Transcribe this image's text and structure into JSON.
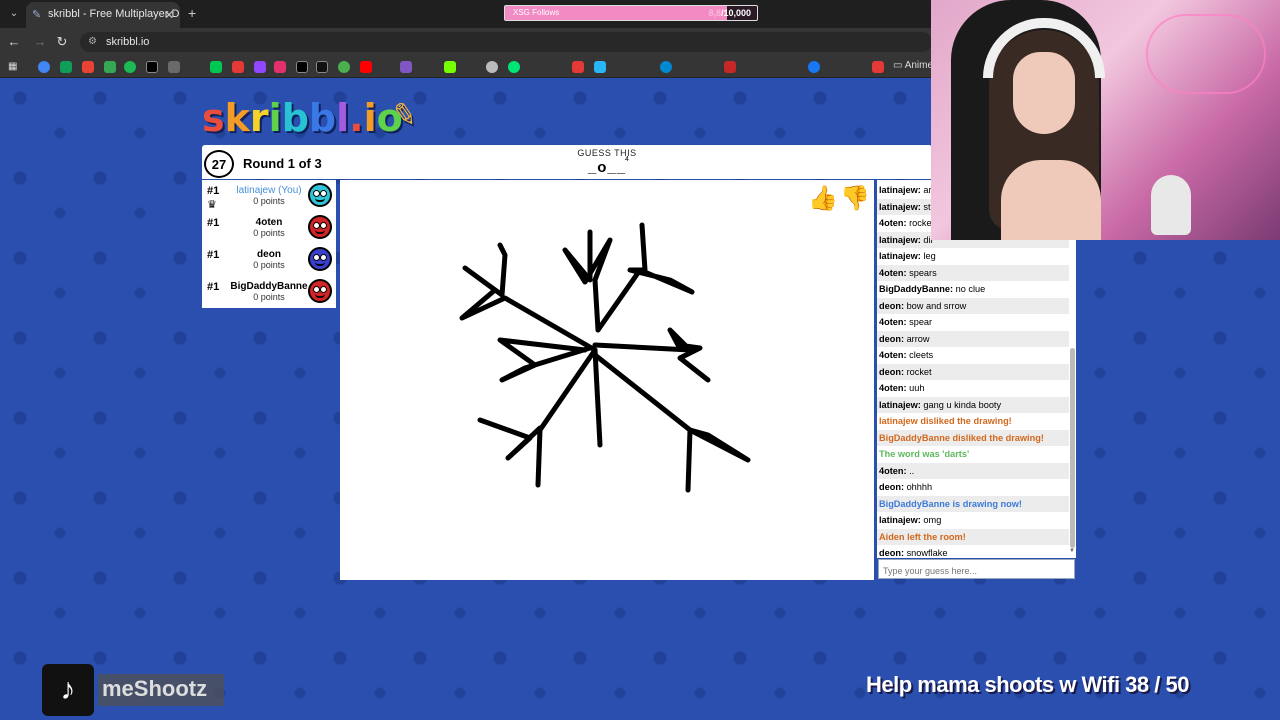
{
  "browser": {
    "tab_title": "skribbl - Free Multiplayer Draw",
    "url": "skribbl.io",
    "bookmark_folder": "Anime"
  },
  "stream_overlay": {
    "follows_label": "XSG Follows",
    "follows_count": "8,8",
    "follows_goal": "/10,000",
    "tiktok_handle": "meShootz",
    "goal_text": "Help mama shoots w Wifi  38 / 50"
  },
  "game": {
    "logo": [
      "s",
      "k",
      "r",
      "i",
      "b",
      "b",
      "l",
      ".",
      "i",
      "o"
    ],
    "timer": "27",
    "round": "Round 1 of 3",
    "guess_label": "GUESS THIS",
    "word_hint": "_o__",
    "letter_count": "4",
    "players": [
      {
        "rank": "#1",
        "name": "latinajew (You)",
        "points": "0 points",
        "color": "#2ec6d6",
        "is_you": true
      },
      {
        "rank": "#1",
        "name": "4oten",
        "points": "0 points",
        "color": "#d32525",
        "is_you": false
      },
      {
        "rank": "#1",
        "name": "deon",
        "points": "0 points",
        "color": "#3a3fd0",
        "is_you": false
      },
      {
        "rank": "#1",
        "name": "BigDaddyBanne",
        "points": "0 points",
        "color": "#d32525",
        "is_you": false
      }
    ],
    "chat": [
      {
        "user": "latinajew:",
        "text": " ar",
        "type": "normal"
      },
      {
        "user": "latinajew:",
        "text": " st",
        "type": "normal"
      },
      {
        "user": "4oten:",
        "text": " rocke",
        "type": "normal"
      },
      {
        "user": "latinajew:",
        "text": " dir",
        "type": "normal"
      },
      {
        "user": "latinajew:",
        "text": " leg",
        "type": "normal"
      },
      {
        "user": "4oten:",
        "text": " spears",
        "type": "normal"
      },
      {
        "user": "BigDaddyBanne:",
        "text": " no clue",
        "type": "normal"
      },
      {
        "user": "deon:",
        "text": " bow and srrow",
        "type": "normal"
      },
      {
        "user": "4oten:",
        "text": " spear",
        "type": "normal"
      },
      {
        "user": "deon:",
        "text": " arrow",
        "type": "normal"
      },
      {
        "user": "4oten:",
        "text": " cleets",
        "type": "normal"
      },
      {
        "user": "deon:",
        "text": " rocket",
        "type": "normal"
      },
      {
        "user": "4oten:",
        "text": " uuh",
        "type": "normal"
      },
      {
        "user": "latinajew:",
        "text": " gang u kinda booty",
        "type": "normal"
      },
      {
        "user": "",
        "text": "latinajew disliked the drawing!",
        "type": "orange"
      },
      {
        "user": "",
        "text": "BigDaddyBanne disliked the drawing!",
        "type": "orange"
      },
      {
        "user": "",
        "text": "The word was 'darts'",
        "type": "green"
      },
      {
        "user": "4oten:",
        "text": " ..",
        "type": "normal"
      },
      {
        "user": "deon:",
        "text": " ohhhh",
        "type": "normal"
      },
      {
        "user": "",
        "text": "BigDaddyBanne is drawing now!",
        "type": "blue"
      },
      {
        "user": "latinajew:",
        "text": " omg",
        "type": "normal"
      },
      {
        "user": "",
        "text": "Aiden left the room!",
        "type": "orange"
      },
      {
        "user": "deon:",
        "text": " snowflake",
        "type": "normal"
      }
    ],
    "chat_placeholder": "Type your guess here..."
  },
  "colors": {
    "logo": [
      "#e94d3c",
      "#f39c26",
      "#f5d327",
      "#5dd24a",
      "#27c2d3",
      "#3a78e6",
      "#a35be0",
      "#e94d3c",
      "#f39c26",
      "#5dd24a"
    ]
  }
}
